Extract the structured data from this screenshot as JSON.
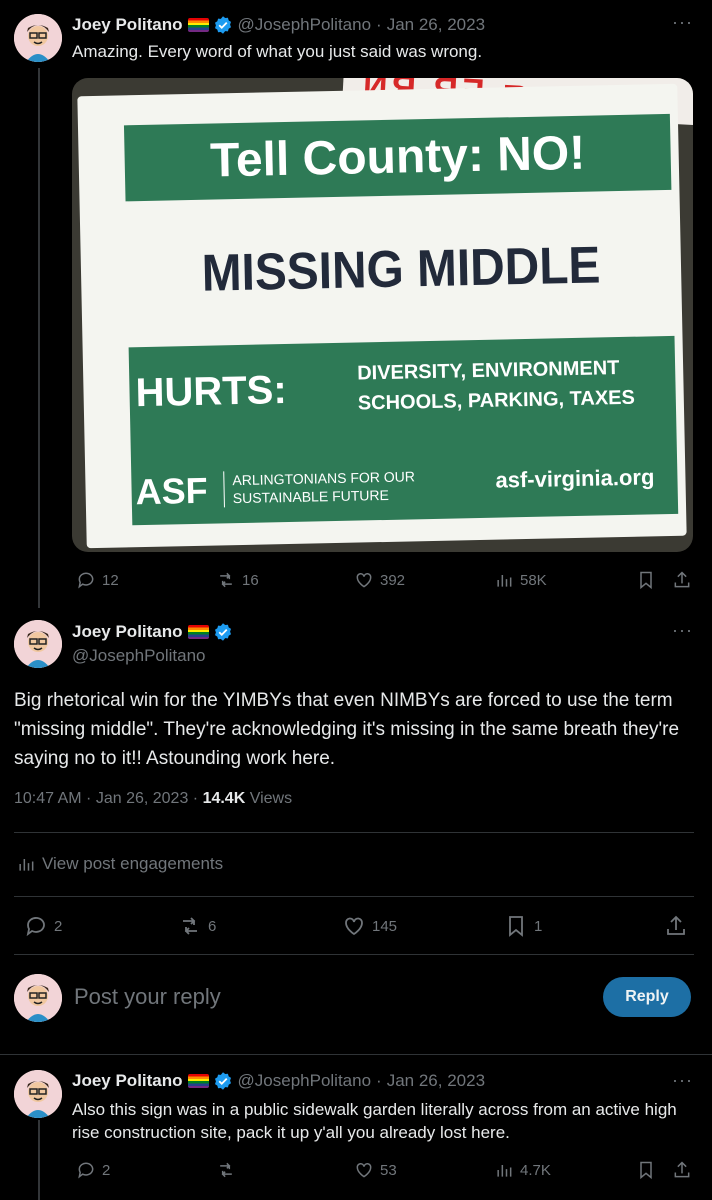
{
  "tweet1": {
    "name": "Joey Politano",
    "handle": "@JosephPolitano",
    "date": "Jan 26, 2023",
    "text": "Amazing. Every word of what you just said was wrong.",
    "more": "···",
    "sign": {
      "title": "Tell County: NO!",
      "headline": "MISSING MIDDLE",
      "hurts": "HURTS:",
      "hurts_line1": "DIVERSITY, ENVIRONMENT",
      "hurts_line2": "SCHOOLS, PARKING, TAXES",
      "org_short": "ASF",
      "org_line1": "ARLINGTONIANS FOR OUR",
      "org_line2": "SUSTAINABLE FUTURE",
      "url": "asf-virginia.org"
    },
    "stats": {
      "replies": "12",
      "reposts": "16",
      "likes": "392",
      "views": "58K"
    }
  },
  "main": {
    "name": "Joey Politano",
    "handle": "@JosephPolitano",
    "more": "···",
    "text": "Big rhetorical win for the YIMBYs that even NIMBYs are forced to use the term \"missing middle\". They're acknowledging it's missing in the same breath they're saying no to it!! Astounding work here.",
    "time": "10:47 AM · Jan 26, 2023 · ",
    "views_count": "14.4K",
    "views_label": " Views",
    "engagements": "View post engagements",
    "stats": {
      "replies": "2",
      "reposts": "6",
      "likes": "145",
      "bookmarks": "1"
    }
  },
  "composer": {
    "placeholder": "Post your reply",
    "button": "Reply"
  },
  "tweet2": {
    "name": "Joey Politano",
    "handle": "@JosephPolitano",
    "date": "Jan 26, 2023",
    "more": "···",
    "text": "Also this sign was in a public sidewalk garden literally across from an active high rise construction site, pack it up y'all you already lost here.",
    "stats": {
      "replies": "2",
      "reposts": "",
      "likes": "53",
      "views": "4.7K"
    }
  },
  "colors": {
    "accent": "#1d9bf0",
    "reply_button": "#1d6fa5",
    "sign_green": "#2e7a56",
    "background": "#000000"
  }
}
